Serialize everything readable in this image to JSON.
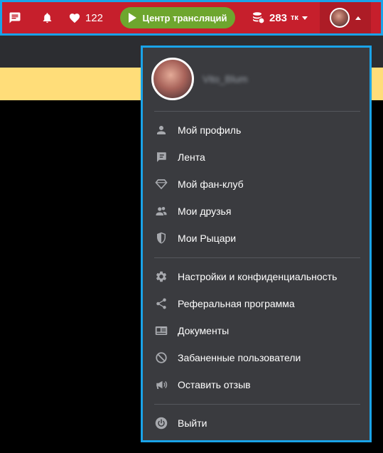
{
  "topbar": {
    "chat_icon": "chat-bubble-icon",
    "bell_icon": "bell-icon",
    "likes": "122",
    "stream_button": "Центр трансляций",
    "tokens_amount": "283",
    "tokens_unit": "тк",
    "brand_color": "#c61f2c",
    "accent_color": "#6ea62e"
  },
  "dropdown": {
    "username": "Vito_Blum",
    "groups": [
      [
        {
          "label": "Мой профиль",
          "icon": "person-icon"
        },
        {
          "label": "Лента",
          "icon": "feed-icon"
        },
        {
          "label": "Мой фан-клуб",
          "icon": "diamond-icon"
        },
        {
          "label": "Мои друзья",
          "icon": "friends-icon"
        },
        {
          "label": "Мои Рыцари",
          "icon": "shield-icon"
        }
      ],
      [
        {
          "label": "Настройки и конфиденциальность",
          "icon": "gear-icon"
        },
        {
          "label": "Реферальная программа",
          "icon": "share-icon"
        },
        {
          "label": "Документы",
          "icon": "id-card-icon"
        },
        {
          "label": "Забаненные пользователи",
          "icon": "ban-icon"
        },
        {
          "label": "Оставить отзыв",
          "icon": "megaphone-icon"
        }
      ],
      [
        {
          "label": "Выйти",
          "icon": "power-icon"
        }
      ]
    ]
  }
}
